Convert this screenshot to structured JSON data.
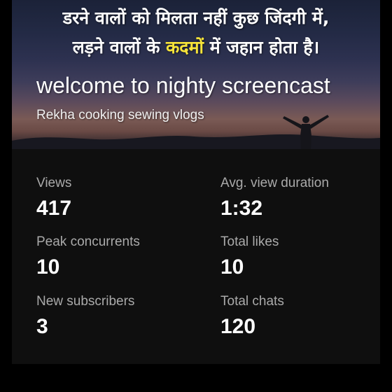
{
  "thumbnail": {
    "quote_line1": "डरने वालों को मिलता नहीं कुछ जिंदगी में,",
    "quote_line2_part1": "लड़ने वालों के ",
    "quote_line2_highlight": "कदमों",
    "quote_line2_part2": " में जहान होता है।",
    "highlight_color": "#f7e43a"
  },
  "stream": {
    "title": "welcome to nighty screencast",
    "channel": "Rekha cooking sewing vlogs"
  },
  "stats": {
    "views": {
      "label": "Views",
      "value": "417"
    },
    "avg_view_duration": {
      "label": "Avg. view duration",
      "value": "1:32"
    },
    "peak_concurrents": {
      "label": "Peak concurrents",
      "value": "10"
    },
    "total_likes": {
      "label": "Total likes",
      "value": "10"
    },
    "new_subscribers": {
      "label": "New subscribers",
      "value": "3"
    },
    "total_chats": {
      "label": "Total chats",
      "value": "120"
    }
  },
  "colors": {
    "background": "#000000",
    "card": "#0f0f0f",
    "label": "#aaaaaa",
    "value": "#ffffff"
  }
}
